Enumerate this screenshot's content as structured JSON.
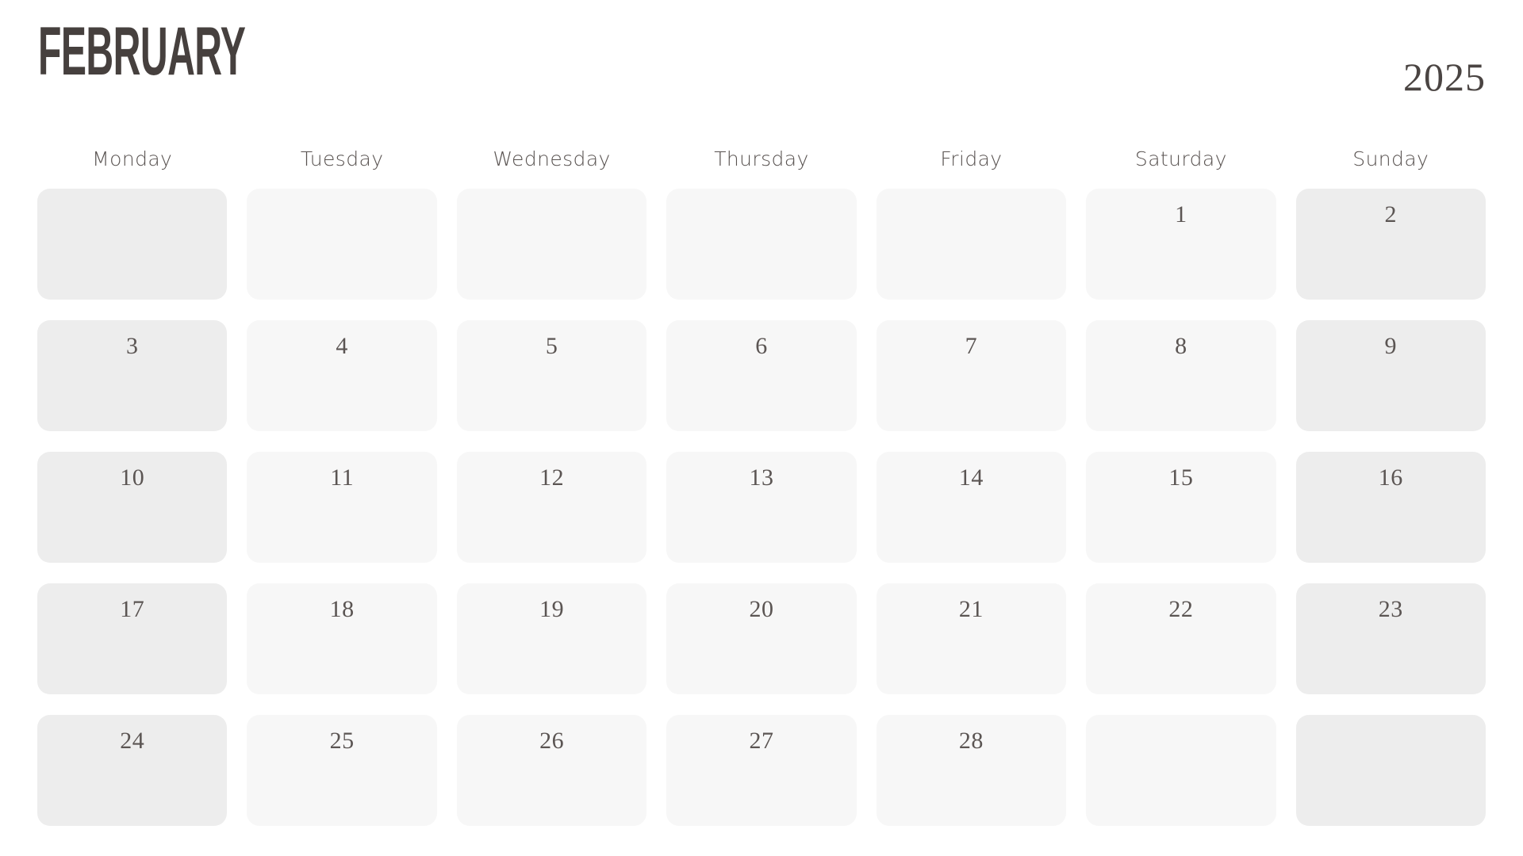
{
  "header": {
    "month_title": "FEBRUARY",
    "year": "2025"
  },
  "weekdays": [
    {
      "label": "Monday",
      "shaded": true
    },
    {
      "label": "Tuesday",
      "shaded": false
    },
    {
      "label": "Wednesday",
      "shaded": false
    },
    {
      "label": "Thursday",
      "shaded": false
    },
    {
      "label": "Friday",
      "shaded": false
    },
    {
      "label": "Saturday",
      "shaded": false
    },
    {
      "label": "Sunday",
      "shaded": true
    }
  ],
  "colors": {
    "page_background": "#ffffff",
    "title_text": "#46403e",
    "year_text": "#4a4442",
    "weekday_text": "#585250",
    "day_number_text": "#5b5553",
    "cell_light": "#f7f7f7",
    "cell_shaded": "#ededed"
  },
  "weeks": [
    [
      "",
      "",
      "",
      "",
      "",
      "1",
      "2"
    ],
    [
      "3",
      "4",
      "5",
      "6",
      "7",
      "8",
      "9"
    ],
    [
      "10",
      "11",
      "12",
      "13",
      "14",
      "15",
      "16"
    ],
    [
      "17",
      "18",
      "19",
      "20",
      "21",
      "22",
      "23"
    ],
    [
      "24",
      "25",
      "26",
      "27",
      "28",
      "",
      ""
    ]
  ]
}
